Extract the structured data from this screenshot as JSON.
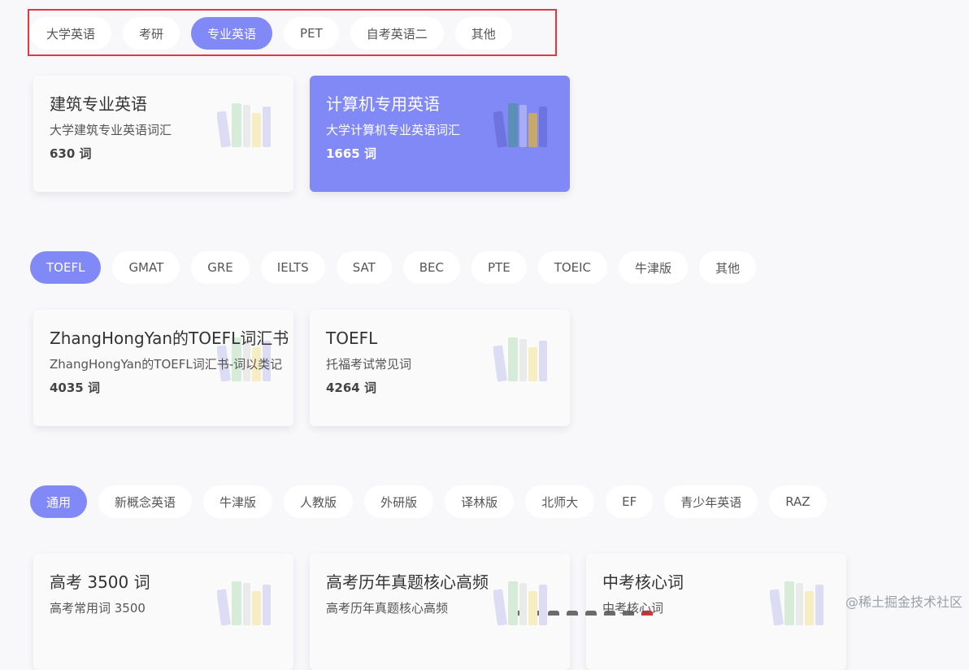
{
  "group1": {
    "tabs": [
      "大学英语",
      "考研",
      "专业英语",
      "PET",
      "自考英语二",
      "其他"
    ],
    "active_index": 2,
    "cards": [
      {
        "title": "建筑专业英语",
        "desc": "大学建筑专业英语词汇",
        "count": "630 词",
        "active": false
      },
      {
        "title": "计算机专用英语",
        "desc": "大学计算机专业英语词汇",
        "count": "1665 词",
        "active": true
      }
    ]
  },
  "group2": {
    "tabs": [
      "TOEFL",
      "GMAT",
      "GRE",
      "IELTS",
      "SAT",
      "BEC",
      "PTE",
      "TOEIC",
      "牛津版",
      "其他"
    ],
    "active_index": 0,
    "cards": [
      {
        "title": "ZhangHongYan的TOEFL词汇书",
        "desc": "ZhangHongYan的TOEFL词汇书-词以类记",
        "count": "4035 词",
        "active": false
      },
      {
        "title": "TOEFL",
        "desc": "托福考试常见词",
        "count": "4264 词",
        "active": false
      }
    ]
  },
  "group3": {
    "tabs": [
      "通用",
      "新概念英语",
      "牛津版",
      "人教版",
      "外研版",
      "译林版",
      "北师大",
      "EF",
      "青少年英语",
      "RAZ"
    ],
    "active_index": 0,
    "cards": [
      {
        "title": "高考 3500 词",
        "desc": "高考常用词 3500",
        "count": "",
        "active": false
      },
      {
        "title": "高考历年真题核心高频",
        "desc": "高考历年真题核心高频",
        "count": "",
        "active": false
      },
      {
        "title": "中考核心词",
        "desc": "中考核心词",
        "count": "",
        "active": false
      }
    ]
  },
  "watermark": "@稀土掘金技术社区",
  "colors": {
    "accent": "#8189f6",
    "highlight_border": "#e0393e",
    "background": "#f8f8fb"
  },
  "icons": {
    "book_illustration": "books-stack-icon"
  }
}
